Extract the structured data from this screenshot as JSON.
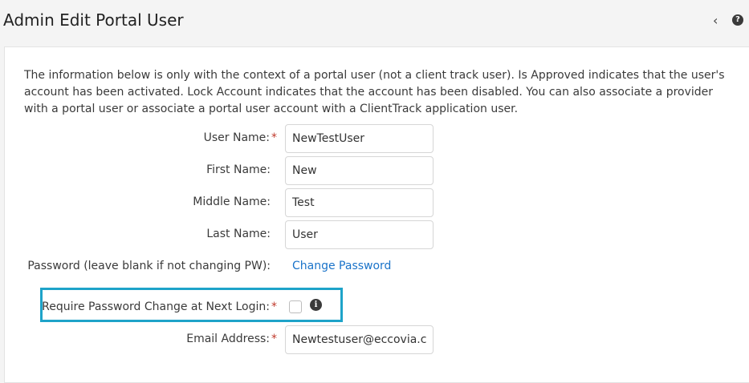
{
  "header": {
    "title": "Admin Edit Portal User",
    "back_icon": "chevron-left-icon",
    "help_icon": "question-circle-icon",
    "help_glyph": "?"
  },
  "intro_text": "The information below is only with the context of a portal user (not a client track user). Is Approved indicates that the user's account has been activated. Lock Account indicates that the account has been disabled. You can also associate a provider with a portal user or associate a portal user account with a ClientTrack application user.",
  "form": {
    "required_marker": "*",
    "user_name": {
      "label": "User Name:",
      "value": "NewTestUser",
      "required": true
    },
    "first_name": {
      "label": "First Name:",
      "value": "New",
      "required": false
    },
    "middle_name": {
      "label": "Middle Name:",
      "value": "Test",
      "required": false
    },
    "last_name": {
      "label": "Last Name:",
      "value": "User",
      "required": false
    },
    "password": {
      "label": "Password (leave blank if not changing PW):",
      "link": "Change Password"
    },
    "require_change": {
      "label": "Require Password Change at Next Login:",
      "checked": false,
      "required": true,
      "info_glyph": "i"
    },
    "email": {
      "label": "Email Address:",
      "value": "Newtestuser@eccovia.com",
      "required": true
    }
  },
  "colors": {
    "highlight_border": "#1ea3c9",
    "link": "#1a73c9",
    "required": "#c0392b"
  }
}
